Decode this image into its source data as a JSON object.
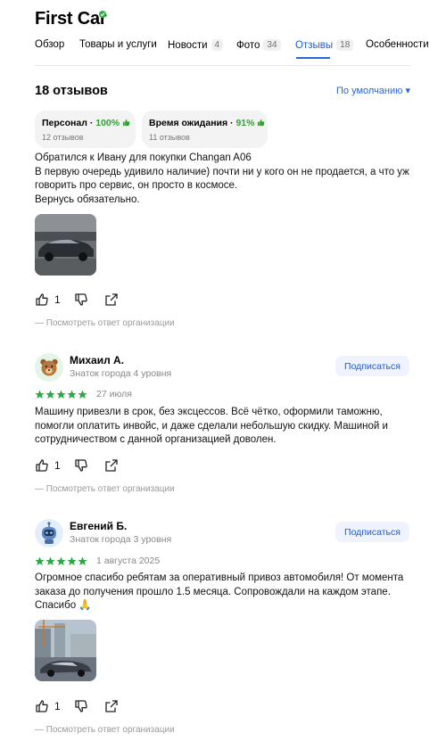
{
  "org": {
    "title": "First Car"
  },
  "tabs": [
    {
      "label": "Обзор"
    },
    {
      "label": "Товары и услуги"
    },
    {
      "label": "Новости",
      "count": "4"
    },
    {
      "label": "Фото",
      "count": "34"
    },
    {
      "label": "Отзывы",
      "count": "18"
    },
    {
      "label": "Особенности"
    }
  ],
  "reviews_header": {
    "count_label": "18 отзывов",
    "sort_label": "По умолчанию ▾"
  },
  "aspects": [
    {
      "name": "Персонал",
      "percent": "100%",
      "count": "12 отзывов"
    },
    {
      "name": "Время ожидания",
      "percent": "91%",
      "count": "11 отзывов"
    }
  ],
  "reviews": [
    {
      "text": [
        "Обратился к Ивану для покупки Changan A06",
        "В первую очередь удивило наличие) почти ни у кого он не продается, а что уж говорить про сервис, он просто в космосе.",
        "Вернусь обязательно."
      ],
      "likes": "1",
      "org_reply": "Посмотреть ответ организации"
    },
    {
      "author": "Михаил А.",
      "level": "Знаток города 4 уровня",
      "subscribe": "Подписаться",
      "rating": 5,
      "date": "27 июля",
      "text": [
        "Машину привезли в срок, без эксцессов. Всё чётко, оформили таможню, помогли оплатить инвойс, и даже сделали небольшую скидку. Машиной и сотрудничеством с данной организацией доволен."
      ],
      "likes": "1",
      "org_reply": "Посмотреть ответ организации"
    },
    {
      "author": "Евгений Б.",
      "level": "Знаток города 3 уровня",
      "subscribe": "Подписаться",
      "rating": 5,
      "date": "1 августа 2025",
      "text": [
        "Огромное спасибо ребятам за оперативный привоз автомобиля! От момента заказа до получения прошло 1.5 месяца. Сопровождали на каждом этапе. Спасибо 🙏"
      ],
      "likes": "1",
      "org_reply": "Посмотреть ответ организации"
    }
  ],
  "colors": {
    "accent": "#2666d8",
    "star": "#2fa84a",
    "positive": "#2fa12f"
  }
}
